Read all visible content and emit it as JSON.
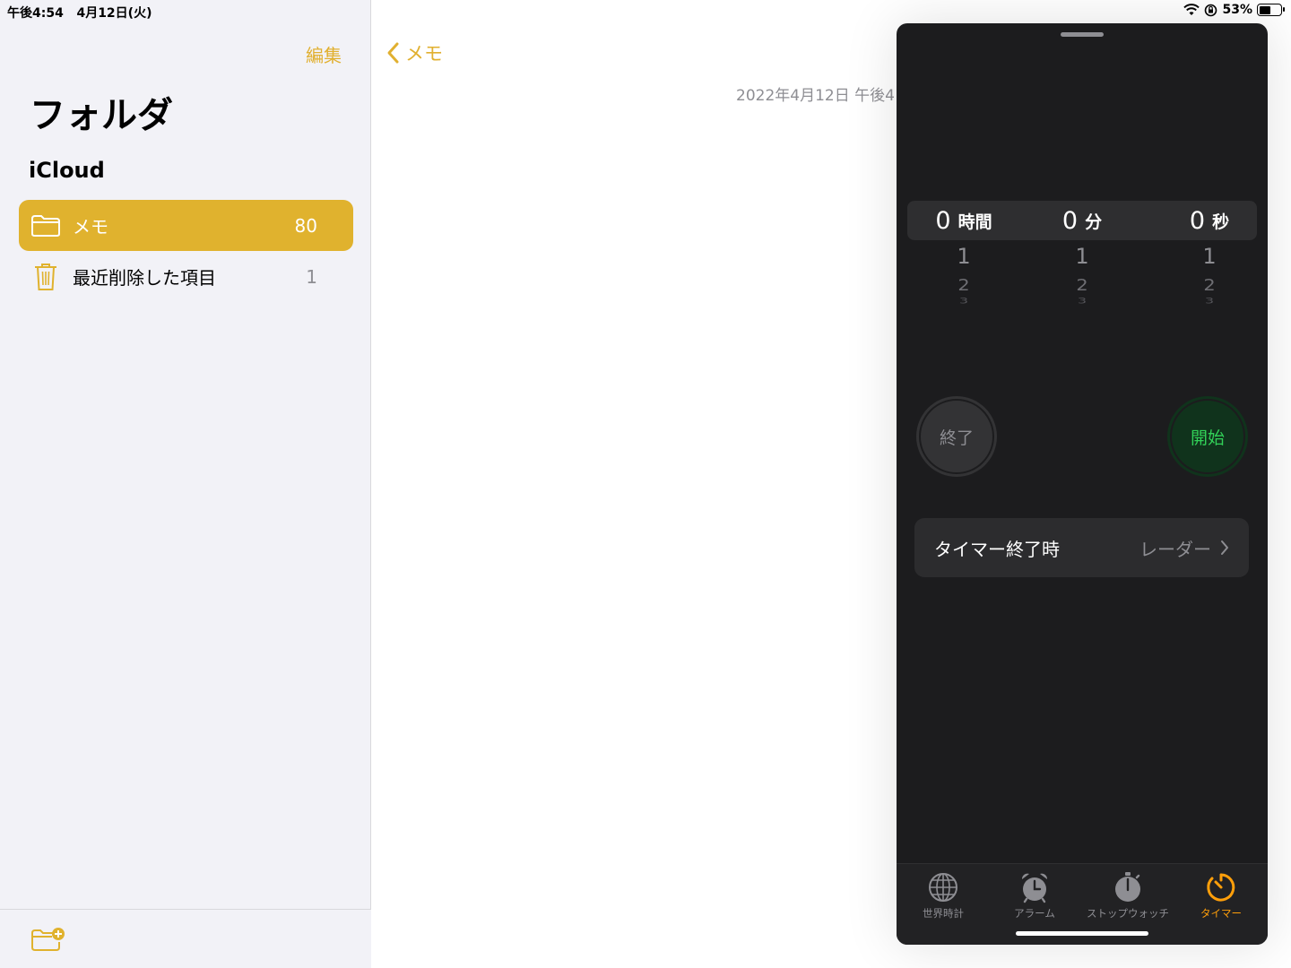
{
  "status_bar": {
    "time": "午後4:54",
    "date": "4月12日(火)",
    "battery": "53%",
    "battery_level": 0.53
  },
  "sidebar": {
    "edit": "編集",
    "title": "フォルダ",
    "section": "iCloud",
    "folders": [
      {
        "label": "メモ",
        "count": "80",
        "icon": "folder-icon",
        "selected": true
      },
      {
        "label": "最近削除した項目",
        "count": "1",
        "icon": "trash-icon",
        "selected": false
      }
    ]
  },
  "note": {
    "back_label": "メモ",
    "date": "2022年4月12日 午後4"
  },
  "timer": {
    "picker": [
      {
        "value": "0",
        "unit": "時間",
        "next": [
          "1",
          "2",
          "3"
        ]
      },
      {
        "value": "0",
        "unit": "分",
        "next": [
          "1",
          "2",
          "3"
        ]
      },
      {
        "value": "0",
        "unit": "秒",
        "next": [
          "1",
          "2",
          "3"
        ]
      }
    ],
    "cancel": "終了",
    "start": "開始",
    "sound_label": "タイマー終了時",
    "sound_value": "レーダー",
    "tabs": [
      {
        "label": "世界時計",
        "icon": "globe-icon"
      },
      {
        "label": "アラーム",
        "icon": "alarm-clock-icon"
      },
      {
        "label": "ストップウォッチ",
        "icon": "stopwatch-icon"
      },
      {
        "label": "タイマー",
        "icon": "timer-icon",
        "active": true
      }
    ]
  },
  "colors": {
    "accent": "#e0b22e",
    "timer_active": "#ff9f0a",
    "start_green": "#32d158"
  }
}
